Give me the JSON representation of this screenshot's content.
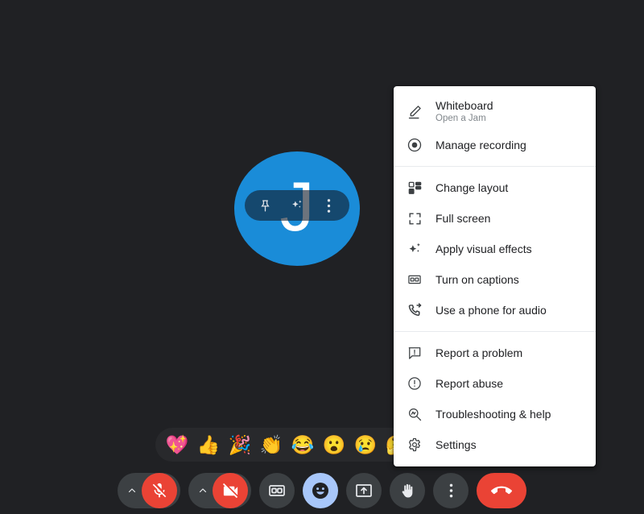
{
  "theme": {
    "background": "#202124",
    "menu_background": "#ffffff",
    "accent_blue": "#a8c7fa",
    "danger_red": "#ea4335",
    "avatar_blue": "#1a8cd8",
    "control_gray": "#3c4043",
    "emoji_bar_background": "#28292c",
    "menu_label_color": "#202124",
    "menu_sub_color": "#80868b"
  },
  "stage": {
    "avatar": {
      "initial": "J",
      "name": "participant-avatar"
    },
    "tile_controls": [
      {
        "icon": "pin-icon",
        "label": "Pin"
      },
      {
        "icon": "visual-effects-icon",
        "label": "Apply visual effects"
      },
      {
        "icon": "more-vertical-icon",
        "label": "More options"
      }
    ]
  },
  "emoji_bar": {
    "reactions": [
      {
        "icon": "sparkling-heart-emoji",
        "glyph": "💖",
        "label": "Sparkling heart"
      },
      {
        "icon": "thumbs-up-emoji",
        "glyph": "👍",
        "label": "Thumbs up"
      },
      {
        "icon": "party-popper-emoji",
        "glyph": "🎉",
        "label": "Party popper"
      },
      {
        "icon": "clapping-hands-emoji",
        "glyph": "👏",
        "label": "Clapping hands"
      },
      {
        "icon": "face-with-tears-of-joy-emoji",
        "glyph": "😂",
        "label": "Face with tears of joy"
      },
      {
        "icon": "face-with-open-mouth-emoji",
        "glyph": "😮",
        "label": "Face with open mouth"
      },
      {
        "icon": "crying-face-emoji",
        "glyph": "😢",
        "label": "Crying face"
      },
      {
        "icon": "thinking-face-emoji",
        "glyph": "🤔",
        "label": "Thinking face"
      }
    ]
  },
  "bottom_bar": {
    "controls": [
      {
        "icon": "microphone-off-icon",
        "label": "Turn on microphone",
        "state": "muted",
        "has_chevron": true
      },
      {
        "icon": "camera-off-icon",
        "label": "Turn on camera",
        "state": "off",
        "has_chevron": true
      },
      {
        "icon": "captions-icon",
        "label": "Turn on captions",
        "state": "default",
        "has_chevron": false
      },
      {
        "icon": "emoji-reaction-icon",
        "label": "Send a reaction",
        "state": "active",
        "has_chevron": false
      },
      {
        "icon": "present-screen-icon",
        "label": "Present now",
        "state": "default",
        "has_chevron": false
      },
      {
        "icon": "raise-hand-icon",
        "label": "Raise hand",
        "state": "default",
        "has_chevron": false
      },
      {
        "icon": "more-options-icon",
        "label": "More options",
        "state": "default",
        "has_chevron": false
      },
      {
        "icon": "end-call-icon",
        "label": "Leave call",
        "state": "danger",
        "has_chevron": false
      }
    ]
  },
  "more_menu": {
    "groups": [
      {
        "items": [
          {
            "icon": "whiteboard-pencil-icon",
            "label": "Whiteboard",
            "sublabel": "Open a Jam"
          },
          {
            "icon": "record-icon",
            "label": "Manage recording",
            "sublabel": ""
          }
        ]
      },
      {
        "items": [
          {
            "icon": "change-layout-icon",
            "label": "Change layout",
            "sublabel": ""
          },
          {
            "icon": "full-screen-icon",
            "label": "Full screen",
            "sublabel": ""
          },
          {
            "icon": "visual-effects-icon",
            "label": "Apply visual effects",
            "sublabel": ""
          },
          {
            "icon": "captions-icon",
            "label": "Turn on captions",
            "sublabel": ""
          },
          {
            "icon": "phone-audio-icon",
            "label": "Use a phone for audio",
            "sublabel": ""
          }
        ]
      },
      {
        "items": [
          {
            "icon": "report-problem-icon",
            "label": "Report a problem",
            "sublabel": ""
          },
          {
            "icon": "report-abuse-icon",
            "label": "Report abuse",
            "sublabel": ""
          },
          {
            "icon": "troubleshooting-icon",
            "label": "Troubleshooting & help",
            "sublabel": ""
          },
          {
            "icon": "settings-gear-icon",
            "label": "Settings",
            "sublabel": ""
          }
        ]
      }
    ]
  }
}
